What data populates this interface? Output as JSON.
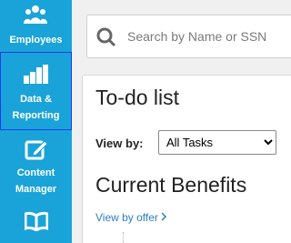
{
  "sidebar": {
    "items": [
      {
        "label": "Employees",
        "icon": "people-icon"
      },
      {
        "label": "Data &\nReporting",
        "icon": "bar-chart-icon"
      },
      {
        "label": "Content\nManager",
        "icon": "edit-icon"
      },
      {
        "label": "",
        "icon": "book-icon"
      }
    ],
    "accent_color": "#1aa3d8",
    "selected_border_color": "#0b3df2"
  },
  "search": {
    "placeholder": "Search by Name or SSN",
    "value": ""
  },
  "todo": {
    "title": "To-do list",
    "view_by_label": "View by:",
    "view_by_selected": "All Tasks"
  },
  "benefits": {
    "title": "Current Benefits",
    "view_by_offer_link": "View by offer"
  }
}
